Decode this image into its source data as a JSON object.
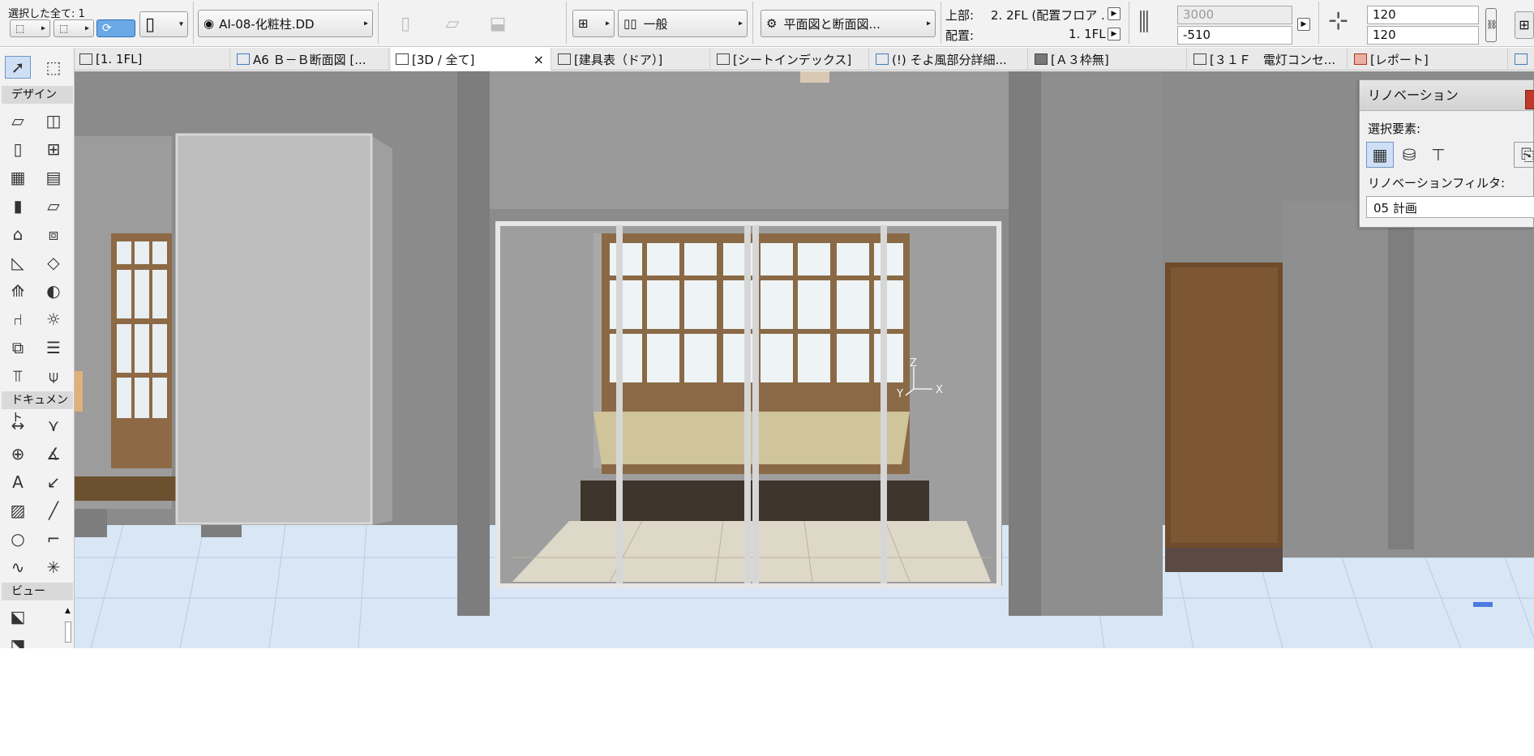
{
  "toolbar": {
    "selection_info": "選択した全て: 1",
    "layer": "AI-08-化粧柱.DD",
    "view_type": "一般",
    "floor_plan_section": "平面図と断面図...",
    "top_label": "上部:",
    "top_value": "2. 2FL (配置フロア ...",
    "placement_label": "配置:",
    "placement_value": "1. 1FL",
    "height_value": "3000",
    "offset_value": "-510",
    "width_value_1": "120",
    "width_value_2": "120"
  },
  "tabs": [
    {
      "label": "[1. 1FL]"
    },
    {
      "label": "A6 Ｂ－Ｂ断面図 [..."
    },
    {
      "label": "[3D / 全て]",
      "active": true,
      "close": "×"
    },
    {
      "label": "[建具表（ドア）]"
    },
    {
      "label": "[シートインデックス]"
    },
    {
      "label": "(!) そよ風部分詳細..."
    },
    {
      "label": "[Ａ３枠無]"
    },
    {
      "label": "[３１Ｆ　電灯コンセ..."
    },
    {
      "label": "[レポート]"
    }
  ],
  "toolbox": {
    "design": "デザイン",
    "document": "ドキュメント",
    "view": "ビュー"
  },
  "renovation": {
    "title": "リノベーション",
    "selected_elements": "選択要素:",
    "filter_label": "リノベーションフィルタ:",
    "filter_value": "05 計画"
  },
  "axes": {
    "x": "X",
    "y": "Y",
    "z": "Z"
  }
}
